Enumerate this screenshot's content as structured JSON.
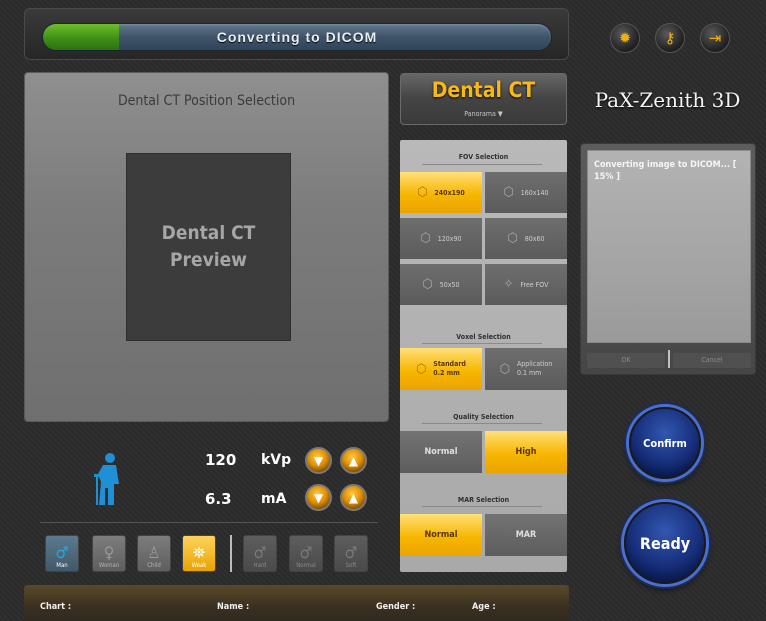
{
  "progress": {
    "text": "Converting to DICOM",
    "percent": 15
  },
  "header_icons": [
    "lamp-icon",
    "key-icon",
    "exit-icon"
  ],
  "position_panel": {
    "title": "Dental CT Position Selection",
    "preview_line1": "Dental CT",
    "preview_line2": "Preview"
  },
  "exposure": {
    "kvp_value": "120",
    "kvp_unit": "kVp",
    "ma_value": "6.3",
    "ma_unit": "mA"
  },
  "patient_types": [
    {
      "label": "Man",
      "selected": true
    },
    {
      "label": "Woman",
      "selected": false
    },
    {
      "label": "Child",
      "selected": false
    },
    {
      "label": "Weak",
      "selected": true
    }
  ],
  "bone_types": [
    {
      "label": "Hard"
    },
    {
      "label": "Normal"
    },
    {
      "label": "Soft"
    }
  ],
  "info": {
    "chart_label": "Chart :",
    "name_label": "Name :",
    "gender_label": "Gender :",
    "age_label": "Age :"
  },
  "mode": {
    "title": "Dental CT",
    "sub": "Panorama ▼"
  },
  "fov": {
    "heading": "FOV Selection",
    "options": [
      {
        "label": "240x190",
        "selected": true
      },
      {
        "label": "160x140",
        "selected": false
      },
      {
        "label": "120x90",
        "selected": false
      },
      {
        "label": "80x60",
        "selected": false
      },
      {
        "label": "50x50",
        "selected": false
      },
      {
        "label": "Free FOV",
        "selected": false
      }
    ]
  },
  "voxel": {
    "heading": "Voxel Selection",
    "options": [
      {
        "line1": "Standard",
        "line2": "0.2 mm",
        "selected": true
      },
      {
        "line1": "Application",
        "line2": "0.1 mm",
        "selected": false
      }
    ]
  },
  "quality": {
    "heading": "Quality Selection",
    "options": [
      "Normal",
      "High"
    ],
    "selected": "High"
  },
  "mar": {
    "heading": "MAR Selection",
    "options": [
      "Normal",
      "MAR"
    ],
    "selected": "Normal"
  },
  "brand": "PaX-Zenith 3D",
  "message": {
    "text": "Converting image to DICOM... [ 15% ]",
    "ok": "OK",
    "cancel": "Cancel"
  },
  "buttons": {
    "confirm": "Confirm",
    "ready": "Ready"
  },
  "colors": {
    "accent_gold": "#f7b600",
    "progress_green": "#3f8f17",
    "button_blue": "#172e7a"
  }
}
